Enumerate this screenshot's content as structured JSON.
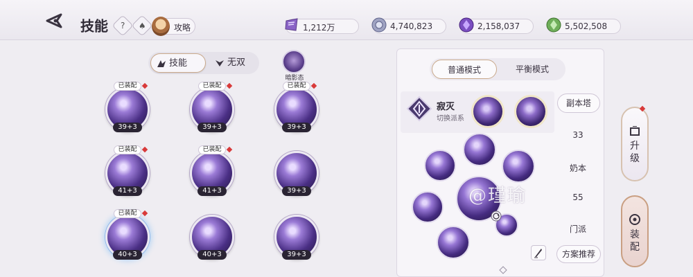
{
  "header": {
    "title": "技能",
    "help_label": "?",
    "guide_label": "攻略"
  },
  "resources": [
    {
      "name": "purple-scroll-icon",
      "value": "1,212万"
    },
    {
      "name": "silver-coin-icon",
      "value": "4,740,823"
    },
    {
      "name": "purple-gem-icon",
      "value": "2,158,037"
    },
    {
      "name": "green-jade-icon",
      "value": "5,502,508"
    }
  ],
  "tabs": {
    "skill": "技能",
    "wushuang": "无双",
    "hidden_form": "暗影态"
  },
  "skills": [
    {
      "equipped": "已装配",
      "level": "39+3"
    },
    {
      "equipped": "已装配",
      "level": "39+3"
    },
    {
      "equipped": "已装配",
      "level": "39+3"
    },
    {
      "equipped": "已装配",
      "level": "41+3"
    },
    {
      "equipped": "已装配",
      "level": "41+3"
    },
    {
      "equipped": "",
      "level": "39+3"
    },
    {
      "equipped": "已装配",
      "level": "40+3"
    },
    {
      "equipped": "",
      "level": "40+3"
    },
    {
      "equipped": "",
      "level": "39+3"
    }
  ],
  "panel": {
    "mode_normal": "普通模式",
    "mode_balanced": "平衡模式",
    "school": "寂灭",
    "school_sub": "切换派系",
    "dungeon_tower": "副本塔",
    "val1": "33",
    "healer": "奶本",
    "val2": "55",
    "sect": "门派",
    "recommend": "方案推荐"
  },
  "side": {
    "upgrade": [
      "升",
      "级"
    ],
    "equip": [
      "装",
      "配"
    ]
  },
  "watermark": "@瑾瑜"
}
